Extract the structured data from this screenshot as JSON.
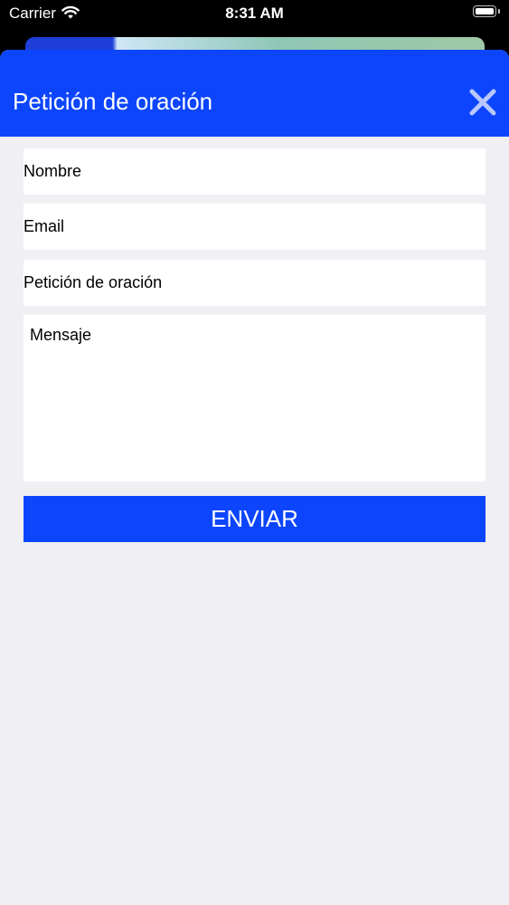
{
  "status_bar": {
    "carrier": "Carrier",
    "time": "8:31 AM"
  },
  "sheet": {
    "title": "Petición de oración",
    "close_icon": "close-icon"
  },
  "form": {
    "name_placeholder": "Nombre",
    "email_placeholder": "Email",
    "request_placeholder": "Petición de oración",
    "message_placeholder": "Mensaje",
    "submit_label": "ENVIAR"
  },
  "colors": {
    "accent": "#0c45fc",
    "sheet_background": "#efeff4",
    "field_background": "#ffffff"
  }
}
